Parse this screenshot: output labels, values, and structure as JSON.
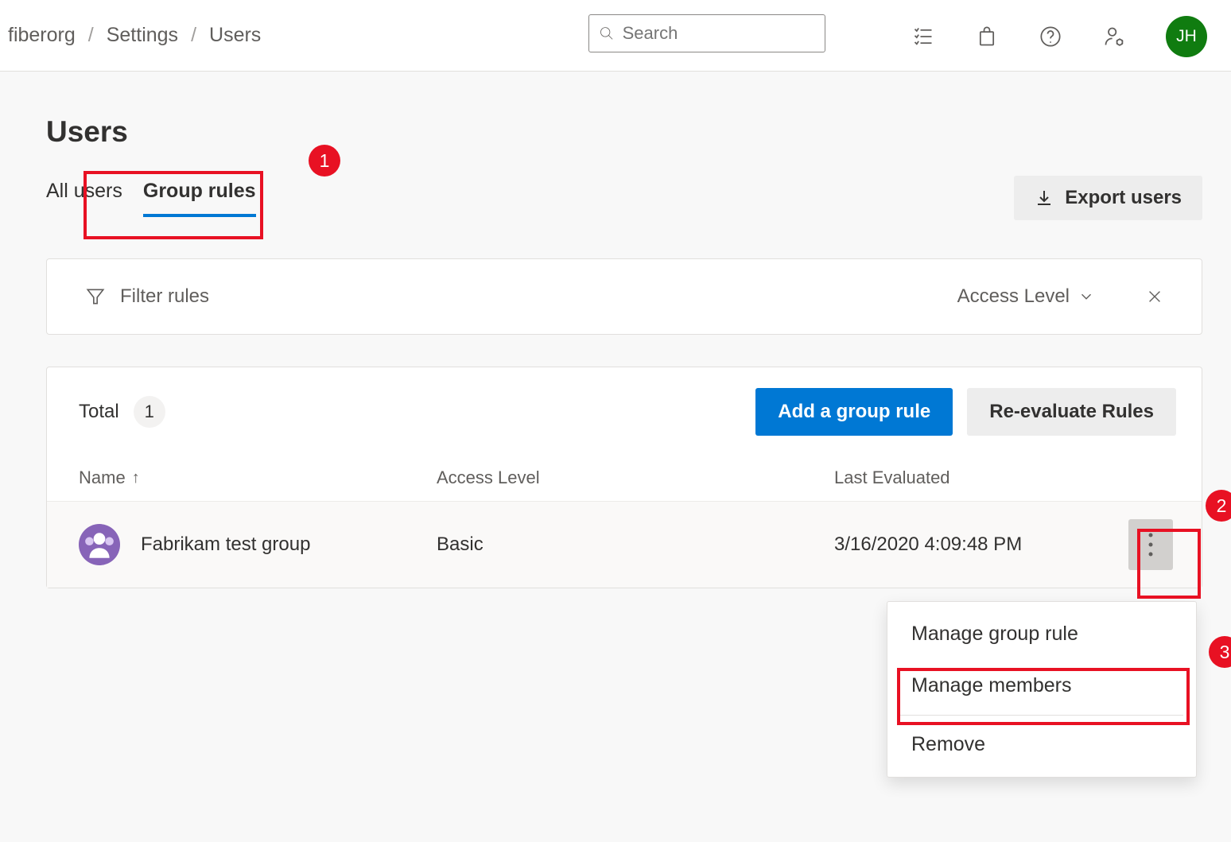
{
  "header": {
    "breadcrumbs": [
      "fiberorg",
      "Settings",
      "Users"
    ],
    "search_placeholder": "Search",
    "avatar_initials": "JH"
  },
  "page": {
    "title": "Users",
    "tabs": [
      {
        "label": "All users",
        "active": false
      },
      {
        "label": "Group rules",
        "active": true
      }
    ],
    "export_label": "Export users"
  },
  "filter": {
    "placeholder": "Filter rules",
    "dropdown_label": "Access Level"
  },
  "table": {
    "total_label": "Total",
    "total_count": "1",
    "add_label": "Add a group rule",
    "reevaluate_label": "Re-evaluate Rules",
    "columns": {
      "name": "Name",
      "access": "Access Level",
      "last": "Last Evaluated"
    },
    "rows": [
      {
        "name": "Fabrikam test group",
        "access": "Basic",
        "last": "3/16/2020 4:09:48 PM"
      }
    ]
  },
  "context_menu": {
    "items": [
      "Manage group rule",
      "Manage members",
      "Remove"
    ]
  },
  "annotations": {
    "b1": "1",
    "b2": "2",
    "b3": "3"
  }
}
